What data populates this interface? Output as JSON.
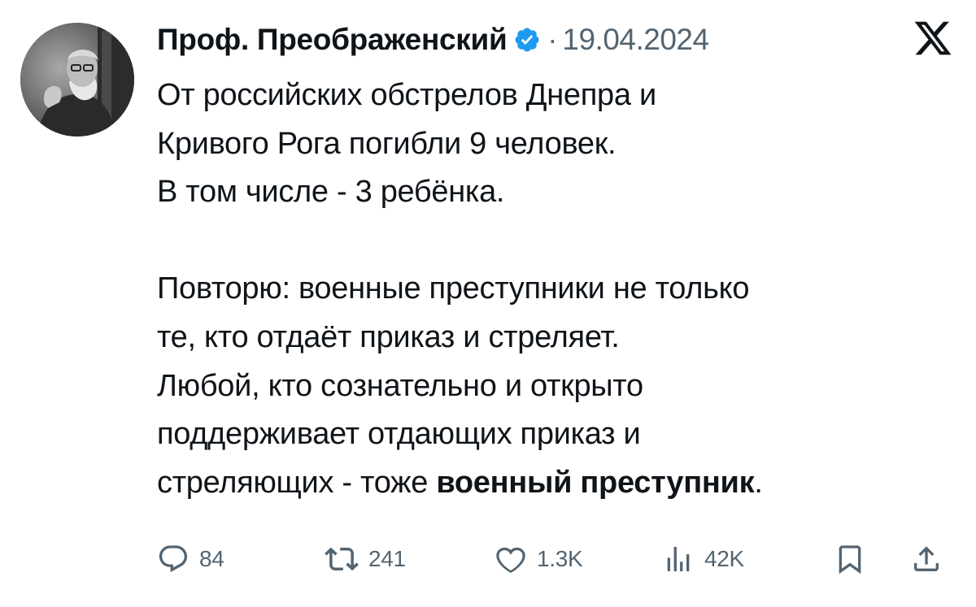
{
  "author": {
    "name": "Проф. Преображенский",
    "verified": true,
    "date": "19.04.2024"
  },
  "platform_logo": "x-logo-icon",
  "post": {
    "paragraph1": [
      "От российских обстрелов Днепра и",
      "Кривого Рога погибли 9 человек.",
      "В том числе - 3 ребёнка."
    ],
    "paragraph2": [
      "Повторю: военные преступники не только",
      "те, кто отдаёт приказ и стреляет.",
      "Любой, кто сознательно и открыто",
      "поддерживает отдающих приказ и"
    ],
    "last_line_prefix": "стреляющих - тоже ",
    "last_line_bold": "военный преступник",
    "last_line_suffix": "."
  },
  "actions": {
    "replies": "84",
    "reposts": "241",
    "likes": "1.3K",
    "views": "42K"
  },
  "colors": {
    "verified_blue": "#1d9bf0",
    "secondary_text": "#536471",
    "primary_text": "#0f1419"
  },
  "icons": [
    "reply-icon",
    "repost-icon",
    "like-icon",
    "views-icon",
    "bookmark-icon",
    "share-icon"
  ]
}
